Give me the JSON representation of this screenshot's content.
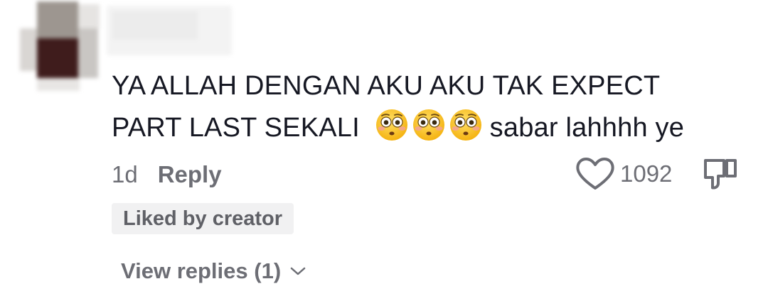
{
  "comment": {
    "line1": "YA ALLAH DENGAN AKU AKU TAK EXPECT",
    "line2_text": "PART LAST SEKALI",
    "emojis": [
      "flushed-face-emoji",
      "flushed-face-emoji",
      "flushed-face-emoji"
    ],
    "line2_tail": "sabar lahhhh ye",
    "time": "1d",
    "reply_label": "Reply",
    "like_count": "1092",
    "liked_by_creator_label": "Liked by creator",
    "view_replies_label": "View replies (1)"
  },
  "icons": {
    "like": "heart-outline-icon",
    "dislike": "thumbs-down-outline-icon",
    "chevron": "chevron-down-icon"
  },
  "colors": {
    "text_primary": "#161823",
    "text_secondary": "#6d6e75",
    "badge_bg": "#f1f1f2",
    "emoji_yellow": "#f7c12a"
  }
}
